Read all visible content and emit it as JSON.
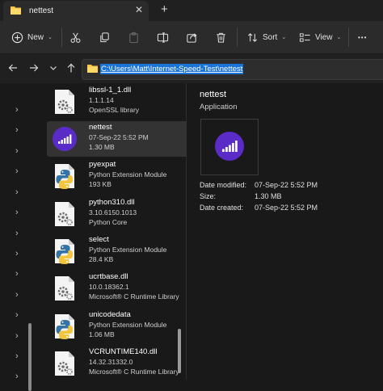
{
  "tab": {
    "title": "nettest",
    "close_glyph": "✕",
    "new_tab_glyph": "+"
  },
  "toolbar": {
    "new_label": "New",
    "sort_label": "Sort",
    "view_label": "View",
    "more_glyph": "•••"
  },
  "address": {
    "path": "C:\\Users\\Matt\\Internet-Speed-Test\\nettest"
  },
  "files": [
    {
      "name": "libssl-1_1.dll",
      "line2": "1.1.1.14",
      "line3": "OpenSSL library",
      "icon": "dll-gear-icon"
    },
    {
      "name": "nettest",
      "line2": "07-Sep-22 5:52 PM",
      "line3": "1.30 MB",
      "icon": "nettest-app-icon"
    },
    {
      "name": "pyexpat",
      "line2": "Python Extension Module",
      "line3": "193 KB",
      "icon": "python-icon"
    },
    {
      "name": "python310.dll",
      "line2": "3.10.6150.1013",
      "line3": "Python Core",
      "icon": "dll-gear-icon"
    },
    {
      "name": "select",
      "line2": "Python Extension Module",
      "line3": "28.4 KB",
      "icon": "python-icon"
    },
    {
      "name": "ucrtbase.dll",
      "line2": "10.0.18362.1",
      "line3": "Microsoft® C Runtime Library",
      "icon": "dll-gear-icon"
    },
    {
      "name": "unicodedata",
      "line2": "Python Extension Module",
      "line3": "1.06 MB",
      "icon": "python-icon"
    },
    {
      "name": "VCRUNTIME140.dll",
      "line2": "14.32.31332.0",
      "line3": "Microsoft® C Runtime Library",
      "icon": "dll-gear-icon"
    }
  ],
  "details": {
    "title": "nettest",
    "type": "Application",
    "props": [
      {
        "label": "Date modified:",
        "value": "07-Sep-22 5:52 PM"
      },
      {
        "label": "Size:",
        "value": "1.30 MB"
      },
      {
        "label": "Date created:",
        "value": "07-Sep-22 5:52 PM"
      }
    ]
  },
  "colors": {
    "accent_purple": "#5b2bc8",
    "selection_blue": "#1a73d9",
    "folder_yellow": "#f5c342"
  }
}
